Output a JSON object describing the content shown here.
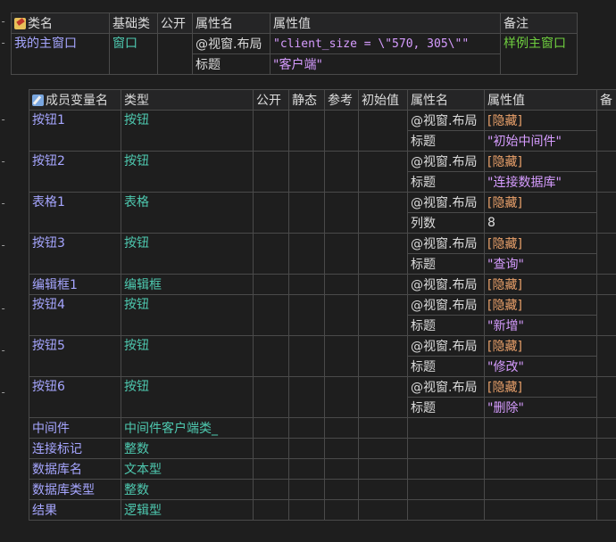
{
  "class_table": {
    "headers": {
      "class_name": "类名",
      "base_class": "基础类",
      "public": "公开",
      "prop_name": "属性名",
      "prop_value": "属性值",
      "note": "备注"
    },
    "row": {
      "class_name": "我的主窗口",
      "base_class": "窗口",
      "note": "样例主窗口",
      "props": [
        {
          "name": "@视窗.布局",
          "value": "\"client_size = \\\"570, 305\\\"\""
        },
        {
          "name": "标题",
          "value": "\"客户端\""
        }
      ]
    }
  },
  "member_table": {
    "headers": {
      "member_name": "成员变量名",
      "type": "类型",
      "public": "公开",
      "static": "静态",
      "ref": "参考",
      "initial": "初始值",
      "prop_name": "属性名",
      "prop_value": "属性值",
      "note": "备"
    },
    "rows": [
      {
        "name": "按钮1",
        "type": "按钮",
        "p1": {
          "name": "@视窗.布局",
          "value": "[隐藏]"
        },
        "p2": {
          "name": "标题",
          "value": "\"初始中间件\""
        }
      },
      {
        "name": "按钮2",
        "type": "按钮",
        "p1": {
          "name": "@视窗.布局",
          "value": "[隐藏]"
        },
        "p2": {
          "name": "标题",
          "value": "\"连接数据库\""
        }
      },
      {
        "name": "表格1",
        "type": "表格",
        "p1": {
          "name": "@视窗.布局",
          "value": "[隐藏]"
        },
        "p2": {
          "name": "列数",
          "value": "8"
        }
      },
      {
        "name": "按钮3",
        "type": "按钮",
        "p1": {
          "name": "@视窗.布局",
          "value": "[隐藏]"
        },
        "p2": {
          "name": "标题",
          "value": "\"查询\""
        }
      },
      {
        "name": "编辑框1",
        "type": "编辑框",
        "p1": {
          "name": "@视窗.布局",
          "value": "[隐藏]"
        }
      },
      {
        "name": "按钮4",
        "type": "按钮",
        "p1": {
          "name": "@视窗.布局",
          "value": "[隐藏]"
        },
        "p2": {
          "name": "标题",
          "value": "\"新增\""
        }
      },
      {
        "name": "按钮5",
        "type": "按钮",
        "p1": {
          "name": "@视窗.布局",
          "value": "[隐藏]"
        },
        "p2": {
          "name": "标题",
          "value": "\"修改\""
        }
      },
      {
        "name": "按钮6",
        "type": "按钮",
        "p1": {
          "name": "@视窗.布局",
          "value": "[隐藏]"
        },
        "p2": {
          "name": "标题",
          "value": "\"删除\""
        }
      },
      {
        "name": "中间件",
        "type": "中间件客户端类_"
      },
      {
        "name": "连接标记",
        "type": "整数"
      },
      {
        "name": "数据库名",
        "type": "文本型"
      },
      {
        "name": "数据库类型",
        "type": "整数"
      },
      {
        "name": "结果",
        "type": "逻辑型"
      }
    ]
  },
  "gutter_marker": "-"
}
